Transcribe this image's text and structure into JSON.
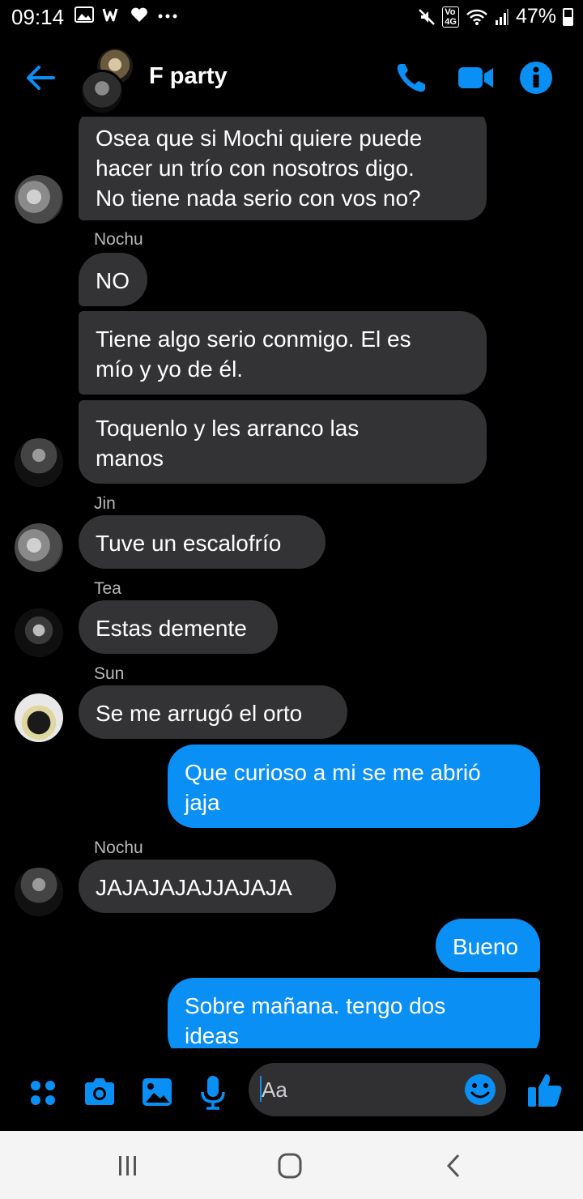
{
  "status_bar": {
    "time": "09:14",
    "battery": "47%",
    "network_badge": "Vo\n4G",
    "left_icons": [
      "image-icon",
      "w-app-icon",
      "heart-icon",
      "more-dots-icon"
    ],
    "right_icons": [
      "mute-icon",
      "volte-icon",
      "wifi-icon",
      "signal-icon",
      "battery-icon"
    ]
  },
  "header": {
    "title": "F party",
    "back_icon": "arrow-left-icon",
    "call_icon": "phone-icon",
    "video_icon": "video-camera-icon",
    "info_icon": "info-icon"
  },
  "colors": {
    "accent": "#0a8ff5",
    "incoming_bubble": "#333335",
    "background": "#000000"
  },
  "messages": [
    {
      "sender": "",
      "text": "Osea que si Mochi quiere puede\nhacer un trío con nosotros digo.\nNo tiene nada serio con vos no?",
      "direction": "in",
      "avatar": "avatar-gray"
    },
    {
      "sender": "Nochu",
      "text": "NO",
      "direction": "in"
    },
    {
      "sender": "",
      "text": "Tiene algo serio conmigo. El es\nmío y yo de él.",
      "direction": "in"
    },
    {
      "sender": "",
      "text": "Toquenlo y les arranco las\nmanos",
      "direction": "in",
      "avatar": "avatar-dark"
    },
    {
      "sender": "Jin",
      "text": "Tuve un escalofrío",
      "direction": "in",
      "avatar": "avatar-gray"
    },
    {
      "sender": "Tea",
      "text": "Estas demente",
      "direction": "in",
      "avatar": "avatar-tea"
    },
    {
      "sender": "Sun",
      "text": "Se me arrugó el orto",
      "direction": "in",
      "avatar": "avatar-sun"
    },
    {
      "sender": "",
      "text": "Que curioso a mi se me abrió\njaja",
      "direction": "out"
    },
    {
      "sender": "Nochu",
      "text": "JAJAJAJAJJAJAJA",
      "direction": "in",
      "avatar": "avatar-dark"
    },
    {
      "sender": "",
      "text": "Bueno",
      "direction": "out"
    },
    {
      "sender": "",
      "text": "Sobre mañana. tengo dos\nideas",
      "direction": "out"
    }
  ],
  "composer": {
    "placeholder": "Aa",
    "icons": [
      "apps-icon",
      "camera-icon",
      "gallery-icon",
      "microphone-icon",
      "emoji-icon",
      "thumbs-up-icon"
    ]
  },
  "nav_bar": {
    "icons": [
      "recents-icon",
      "home-icon",
      "back-icon"
    ]
  }
}
